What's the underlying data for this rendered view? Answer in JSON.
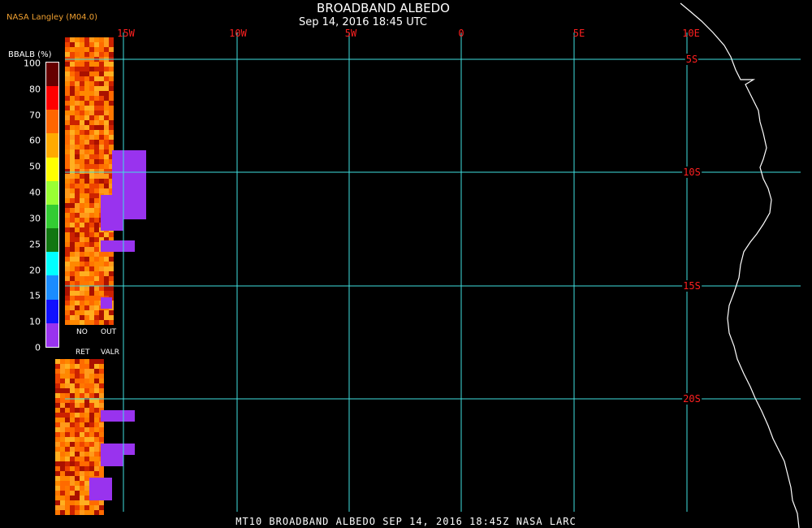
{
  "header": {
    "credit": "NASA Langley (M04.0)",
    "title": "BROADBAND ALBEDO",
    "subtitle": "Sep 14, 2016 18:45 UTC"
  },
  "footer": {
    "text": "MT10  BROADBAND ALBEDO  SEP 14, 2016 18:45Z  NASA LARC"
  },
  "map": {
    "lon_labels": [
      "15W",
      "10W",
      "5W",
      "0",
      "5E",
      "10E"
    ],
    "lat_labels": [
      "5S",
      "10S",
      "15S",
      "20S"
    ],
    "grid_color": "#40e0e0",
    "label_color": "#ff2020",
    "coast_color": "#ffffff",
    "no_retrieval_color": "#9933ee"
  },
  "legend": {
    "title": "BBALB (%)",
    "ticks": [
      "0",
      "10",
      "15",
      "20",
      "25",
      "30",
      "40",
      "50",
      "60",
      "70",
      "80",
      "100"
    ],
    "colors": [
      "#9933ee",
      "#1010ff",
      "#1a8cff",
      "#00ffff",
      "#117711",
      "#33cc33",
      "#99ff33",
      "#ffff00",
      "#ffaa00",
      "#ff6600",
      "#ff0000",
      "#660000"
    ],
    "no_ret_label": "NO",
    "no_ret_label2": "RET",
    "out_valr_label": "OUT",
    "out_valr_label2": "VALR"
  }
}
